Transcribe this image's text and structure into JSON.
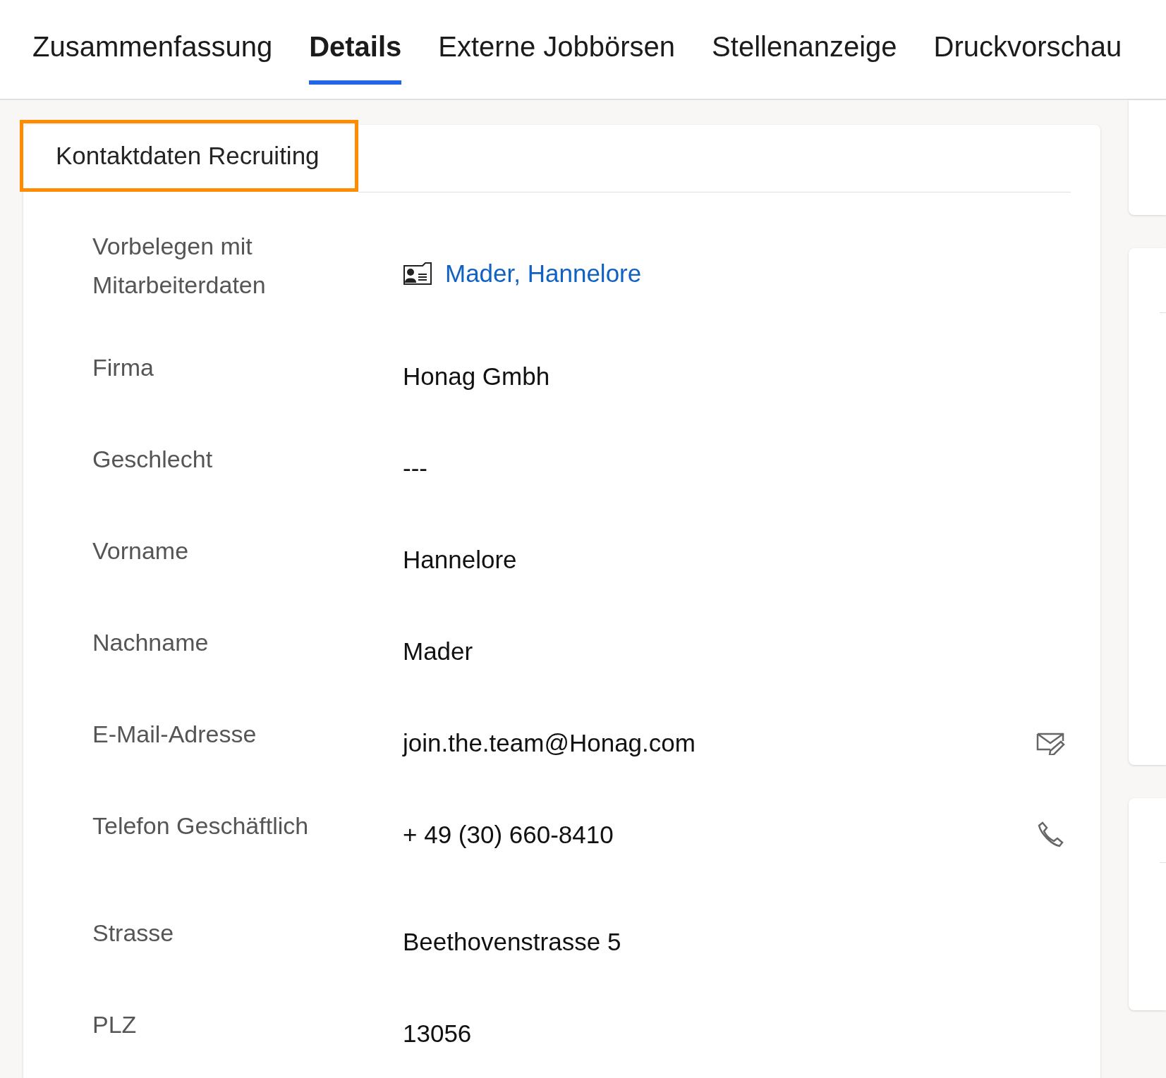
{
  "tabs": [
    {
      "label": "Zusammenfassung",
      "selected": false
    },
    {
      "label": "Details",
      "selected": true
    },
    {
      "label": "Externe Jobbörsen",
      "selected": false
    },
    {
      "label": "Stellenanzeige",
      "selected": false
    },
    {
      "label": "Druckvorschau",
      "selected": false
    }
  ],
  "section": {
    "title": "Kontaktdaten Recruiting",
    "highlighted": true,
    "fields": [
      {
        "label": "Vorbelegen mit Mitarbeiterdaten",
        "value": "Mader, Hannelore",
        "kind": "lookup"
      },
      {
        "label": "Firma",
        "value": "Honag Gmbh",
        "kind": "text"
      },
      {
        "label": "Geschlecht",
        "value": "---",
        "kind": "text"
      },
      {
        "label": "Vorname",
        "value": "Hannelore",
        "kind": "text"
      },
      {
        "label": "Nachname",
        "value": "Mader",
        "kind": "text"
      },
      {
        "label": "E-Mail-Adresse",
        "value": "join.the.team@Honag.com",
        "kind": "email"
      },
      {
        "label": "Telefon Geschäftlich",
        "value": "+ 49 (30) 660-8410",
        "kind": "phone"
      },
      {
        "label": "Strasse",
        "value": "Beethovenstrasse 5",
        "kind": "text"
      },
      {
        "label": "PLZ",
        "value": "13056",
        "kind": "text"
      }
    ]
  }
}
